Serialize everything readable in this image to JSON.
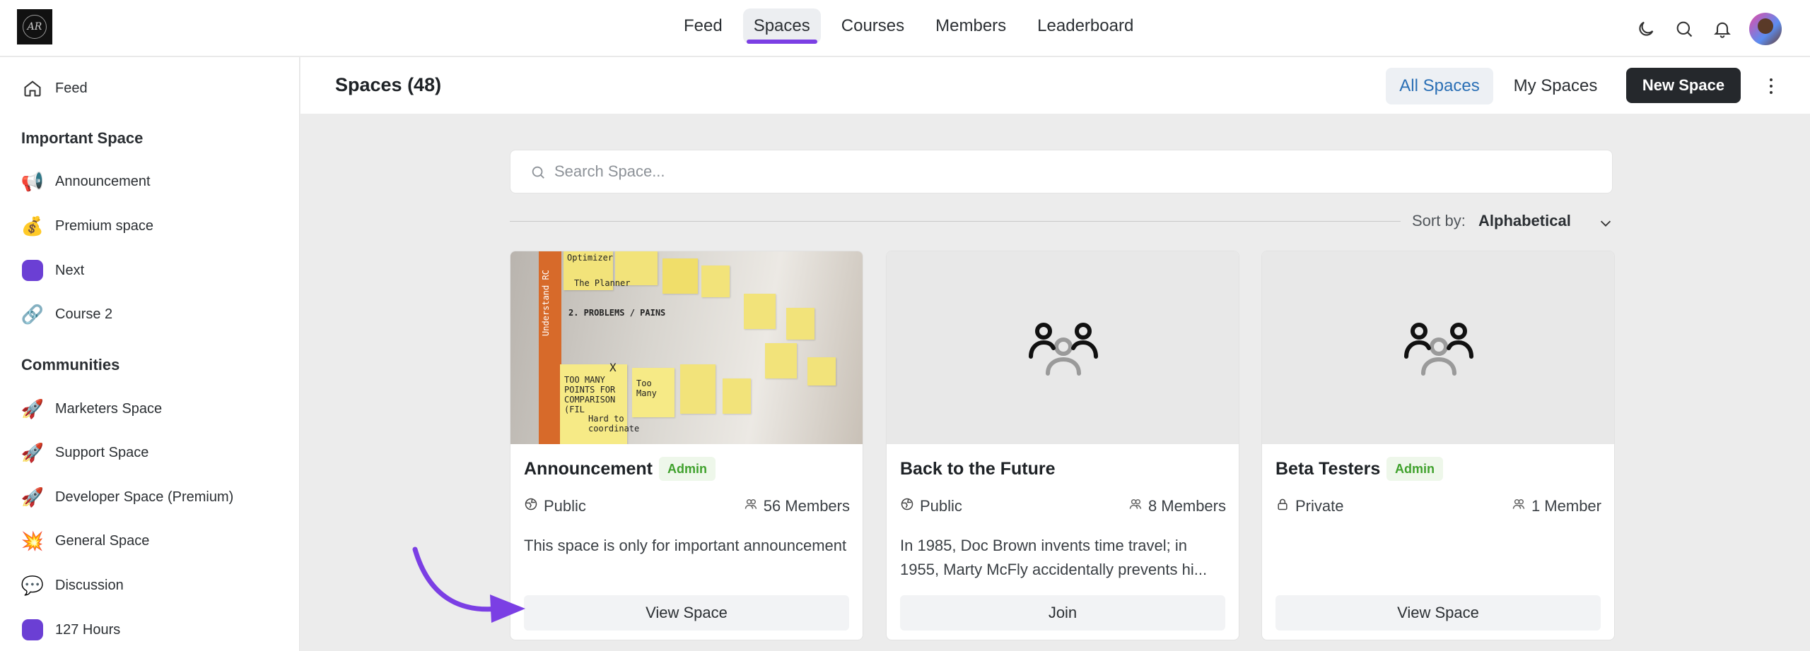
{
  "topbar": {
    "logo_text": "AR",
    "nav": [
      {
        "label": "Feed",
        "active": false
      },
      {
        "label": "Spaces",
        "active": true
      },
      {
        "label": "Courses",
        "active": false
      },
      {
        "label": "Members",
        "active": false
      },
      {
        "label": "Leaderboard",
        "active": false
      }
    ],
    "icons": [
      "moon-icon",
      "search-icon",
      "bell-icon",
      "user-avatar"
    ],
    "accent_color": "#7b3fe4"
  },
  "sidebar": {
    "feed_label": "Feed",
    "important_heading": "Important Space",
    "important_items": [
      {
        "label": "Announcement",
        "icon": "megaphone-icon"
      },
      {
        "label": "Premium space",
        "icon": "money-bag-icon"
      },
      {
        "label": "Next",
        "icon": "purple-square-icon"
      },
      {
        "label": "Course 2",
        "icon": "link-icon"
      }
    ],
    "communities_heading": "Communities",
    "community_items": [
      {
        "label": "Marketers Space",
        "icon": "rocket-icon"
      },
      {
        "label": "Support Space",
        "icon": "rocket-icon"
      },
      {
        "label": "Developer Space (Premium)",
        "icon": "rocket-icon"
      },
      {
        "label": "General Space",
        "icon": "collision-icon"
      },
      {
        "label": "Discussion",
        "icon": "speech-bubble-icon"
      },
      {
        "label": "127 Hours",
        "icon": "purple-square-icon"
      }
    ]
  },
  "header": {
    "title": "Spaces (48)",
    "all_spaces": "All Spaces",
    "my_spaces": "My Spaces",
    "new_space": "New Space"
  },
  "search": {
    "placeholder": "Search Space..."
  },
  "sort": {
    "label": "Sort by:",
    "value": "Alphabetical"
  },
  "cards": [
    {
      "title": "Announcement",
      "badge": "Admin",
      "privacy": "Public",
      "members": "56 Members",
      "description": "This space is only for important announcement",
      "button": "View Space",
      "image": "sticky-notes-photo"
    },
    {
      "title": "Back to the Future",
      "badge": "",
      "privacy": "Public",
      "members": "8 Members",
      "description": "In 1985, Doc Brown invents time travel; in 1955, Marty McFly accidentally prevents hi...",
      "button": "Join",
      "image": "group-placeholder-icon"
    },
    {
      "title": "Beta Testers",
      "badge": "Admin",
      "privacy": "Private",
      "members": "1 Member",
      "description": "",
      "button": "View Space",
      "image": "group-placeholder-icon"
    }
  ],
  "sticky_notes_text": [
    "Optimizer",
    "The Planner",
    "2. PROBLEMS / PAINS",
    "Understand RC",
    "TOO MANY POINTS FOR COMPARISON (FIL",
    "Hard to coordinate",
    "Too Many",
    "X"
  ]
}
